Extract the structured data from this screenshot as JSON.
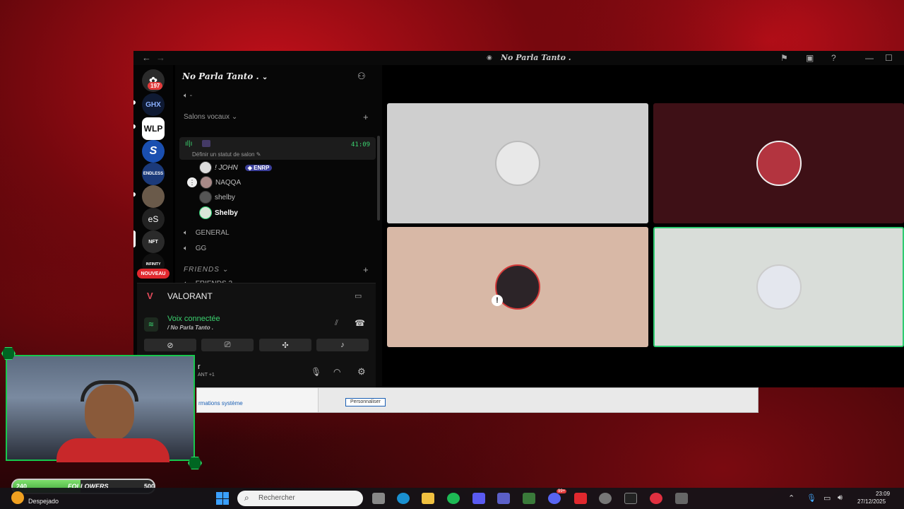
{
  "window": {
    "title": "No Parla Tanto .",
    "back_icon": "←",
    "forward_icon": "→"
  },
  "servers": [
    {
      "name": "server-197",
      "badge": "197",
      "color": "#d23040"
    },
    {
      "name": "server-ghx",
      "label": "GHX",
      "color": "#1a2a55"
    },
    {
      "name": "server-wlp",
      "label": "WLP",
      "color": "#ffffff"
    },
    {
      "name": "server-s",
      "label": "S",
      "color": "#1a4fb0"
    },
    {
      "name": "server-endless",
      "label": "ENDLESS",
      "color": "#1b3a7a"
    },
    {
      "name": "server-photo",
      "label": "",
      "color": "#6a5a4a"
    },
    {
      "name": "server-es",
      "label": "eS",
      "color": "#222222"
    },
    {
      "name": "server-nft",
      "label": "NFT",
      "color": "#2a2a2a"
    },
    {
      "name": "server-infinity",
      "label": "INFINITY",
      "color": "#111111"
    }
  ],
  "nouveau_label": "NOUVEAU",
  "guild": {
    "name": "No Parla Tanto .",
    "top_channel": "-",
    "category_voice": "Salons vocaux",
    "active_status_placeholder": "Définir un statut de salon",
    "active_timer": "41:09",
    "members": [
      {
        "name": "! JOHN",
        "tag": "ENRP"
      },
      {
        "name": "NAQQA"
      },
      {
        "name": "shelby"
      },
      {
        "name": "Shelby"
      }
    ],
    "channels": [
      "GENERAL",
      "GG"
    ],
    "category_friends": "FRIENDS",
    "friends_channels": [
      "FRIENDS 2"
    ]
  },
  "overlay": {
    "game": "VALORANT",
    "voice_status": "Voix connectée",
    "voice_channel": "/ No Parla Tanto .",
    "user_name_partial": "r",
    "user_sub_partial": "ANT +1"
  },
  "sysinfo": {
    "link": "rmations système",
    "button": "Personnaliser"
  },
  "followers": {
    "current": "240",
    "label": "FOLLOWERS",
    "goal": "500",
    "progress": 0.48
  },
  "weather": {
    "label": "Despejado"
  },
  "taskbar": {
    "search_placeholder": "Rechercher",
    "time": "23:09",
    "date": "27/12/2025",
    "discord_badge": "99+"
  }
}
